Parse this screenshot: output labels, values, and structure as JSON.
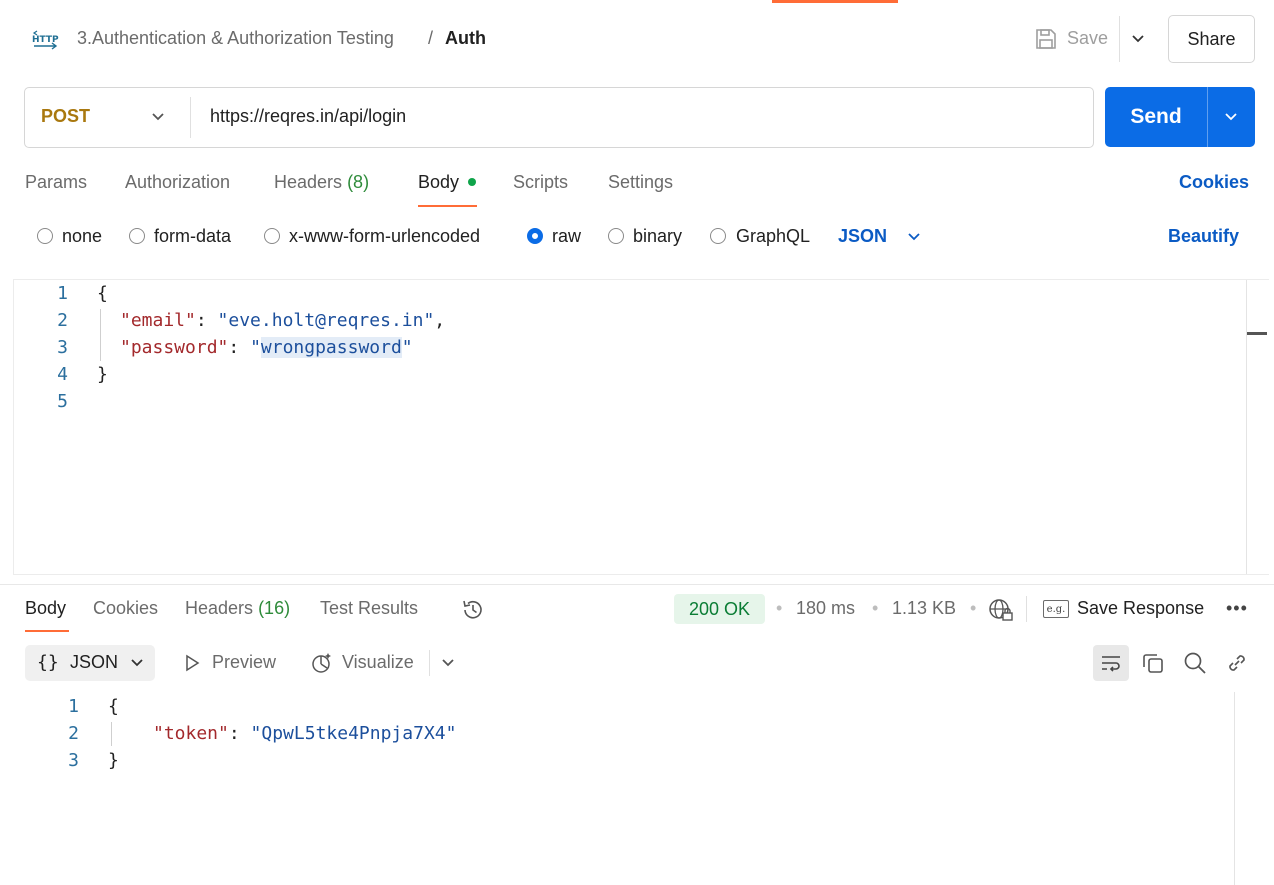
{
  "header": {
    "breadcrumb_parent": "3.Authentication & Authorization Testing",
    "breadcrumb_separator": "/",
    "breadcrumb_current": "Auth",
    "save_label": "Save",
    "share_label": "Share"
  },
  "request": {
    "method": "POST",
    "url": "https://reqres.in/api/login",
    "send_label": "Send",
    "tabs": {
      "params": "Params",
      "authorization": "Authorization",
      "headers": "Headers",
      "headers_count": "(8)",
      "body": "Body",
      "scripts": "Scripts",
      "settings": "Settings"
    },
    "cookies_label": "Cookies",
    "body_types": {
      "none": "none",
      "form_data": "form-data",
      "urlencoded": "x-www-form-urlencoded",
      "raw": "raw",
      "binary": "binary",
      "graphql": "GraphQL"
    },
    "selected_body_type": "raw",
    "raw_format": "JSON",
    "beautify_label": "Beautify",
    "body_lines": {
      "l1": "1",
      "l2": "2",
      "l3": "3",
      "l4": "4",
      "l5": "5",
      "open_brace": "{",
      "email_key": "\"email\"",
      "email_value": "\"eve.holt@reqres.in\"",
      "password_key": "\"password\"",
      "password_value_quote_open": "\"",
      "password_value": "wrongpassword",
      "password_value_quote_close": "\"",
      "close_brace": "}"
    }
  },
  "response": {
    "tabs": {
      "body": "Body",
      "cookies": "Cookies",
      "headers": "Headers",
      "headers_count": "(16)",
      "test_results": "Test Results"
    },
    "status": "200 OK",
    "time": "180 ms",
    "size": "1.13 KB",
    "save_response_label": "Save Response",
    "example_icon_text": "e.g.",
    "format_braces": "{}",
    "format_label": "JSON",
    "preview_label": "Preview",
    "visualize_label": "Visualize",
    "body_lines": {
      "l1": "1",
      "l2": "2",
      "l3": "3",
      "open_brace": "{",
      "token_key": "\"token\"",
      "token_value": "\"QpwL5tke4Pnpja7X4\"",
      "close_brace": "}"
    }
  },
  "icons": {
    "http": "http-icon",
    "save": "save-icon",
    "history": "history-icon",
    "globe": "globe-lock-icon",
    "more": "more-icon",
    "wrap": "wrap-lines-icon",
    "copy": "copy-icon",
    "search": "search-icon",
    "link": "link-icon"
  },
  "colors": {
    "accent": "#ff6c37",
    "send": "#0b6ce6",
    "link": "#0b5bc4",
    "method_post": "#a9780f",
    "status_ok_bg": "#e6f5ea",
    "status_ok_text": "#0b7d35"
  }
}
